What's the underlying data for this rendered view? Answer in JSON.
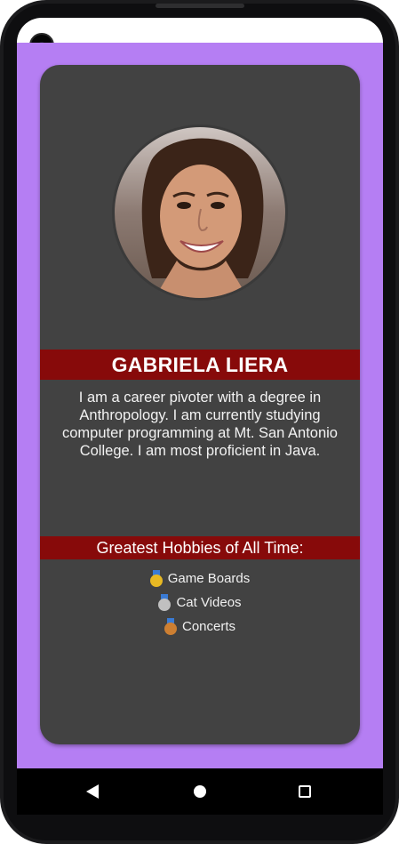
{
  "profile": {
    "name": "GABRIELA LIERA",
    "bio": "I am a career pivoter with a degree in Anthropology. I am currently studying computer programming at Mt. San Antonio College. I am most proficient in Java.",
    "avatar_icon": "profile-photo"
  },
  "hobbies": {
    "title": "Greatest Hobbies of All Time:",
    "items": [
      {
        "label": "Game Boards",
        "medal": "gold-medal-icon",
        "color": "#e8b923"
      },
      {
        "label": "Cat Videos",
        "medal": "silver-medal-icon",
        "color": "#c0c0c0"
      },
      {
        "label": "Concerts",
        "medal": "bronze-medal-icon",
        "color": "#cd7f32"
      }
    ]
  },
  "colors": {
    "background": "#b57ef3",
    "card": "#424242",
    "band": "#870a0a"
  },
  "navbar": {
    "back_icon": "back-triangle-icon",
    "home_icon": "home-circle-icon",
    "recents_icon": "recents-square-icon"
  }
}
